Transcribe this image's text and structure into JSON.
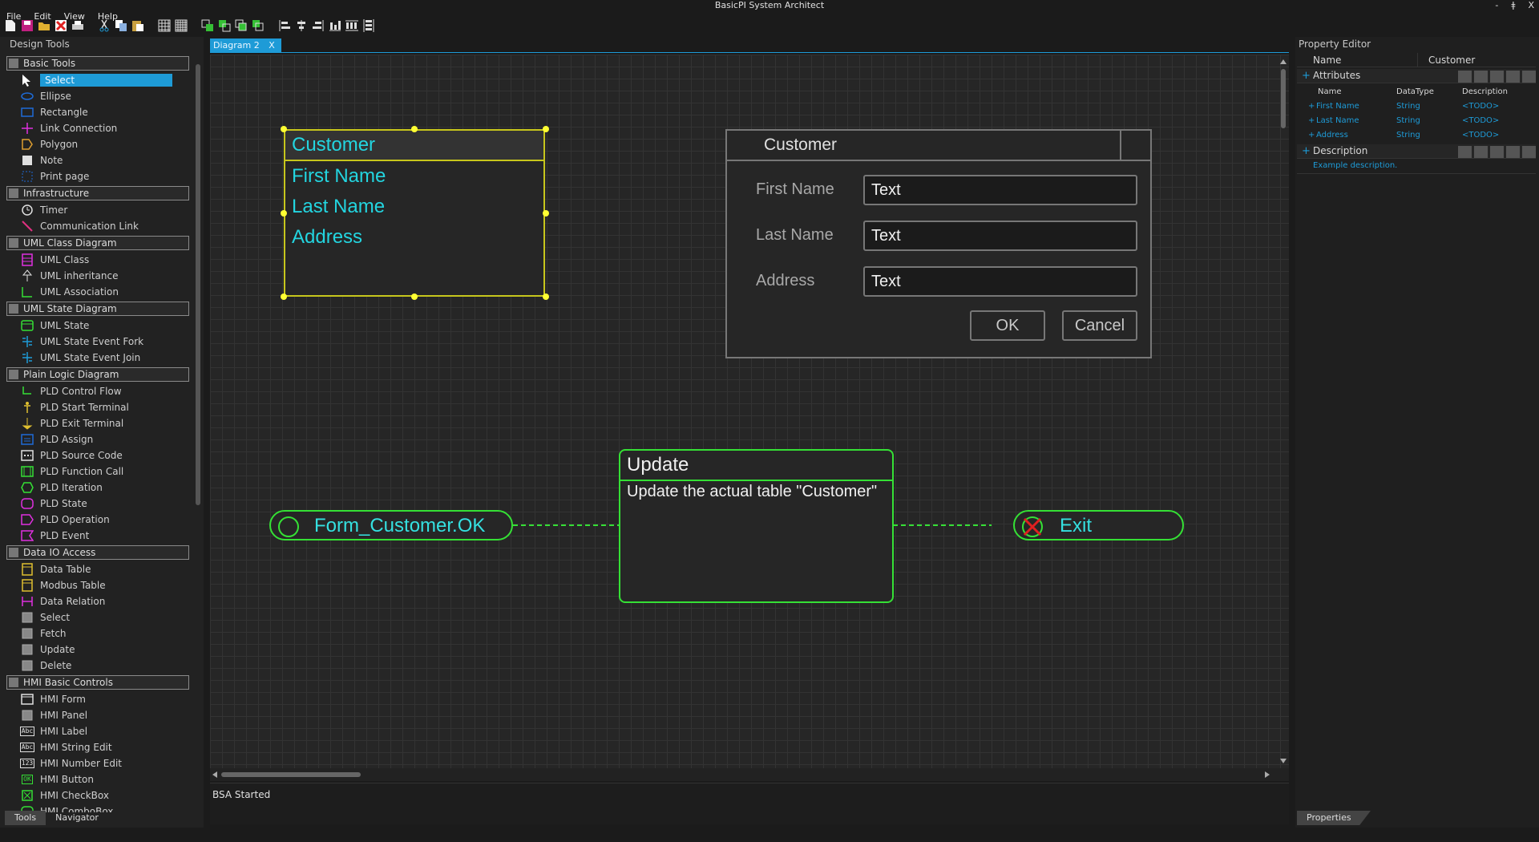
{
  "window": {
    "title": "BasicPI System Architect",
    "controls": [
      "-",
      "ǂ",
      "X"
    ]
  },
  "menu": [
    "File",
    "Edit",
    "View",
    "Help"
  ],
  "toolbar": {
    "icons": [
      "new-icon",
      "save-icon",
      "open-icon",
      "delete-icon",
      "print-icon",
      "cut-icon",
      "copy-icon",
      "paste-icon",
      "grid-icon",
      "grid-snap-icon",
      "bring-front-icon",
      "send-back-icon",
      "bring-forward-icon",
      "send-backward-icon",
      "align-left-icon",
      "align-center-icon",
      "align-right-icon",
      "align-bottom-icon",
      "distribute-h-icon",
      "distribute-v-icon"
    ]
  },
  "left_panel": {
    "title": "Design Tools",
    "groups": [
      {
        "name": "Basic Tools",
        "items": [
          {
            "label": "Select",
            "icon": "cursor-icon",
            "color": "#ffffff",
            "selected": true
          },
          {
            "label": "Ellipse",
            "icon": "ellipse-icon",
            "color": "#1e6bd7"
          },
          {
            "label": "Rectangle",
            "icon": "rectangle-icon",
            "color": "#1e6bd7"
          },
          {
            "label": "Link Connection",
            "icon": "link-icon",
            "color": "#e030e0"
          },
          {
            "label": "Polygon",
            "icon": "polygon-icon",
            "color": "#e0a030"
          },
          {
            "label": "Note",
            "icon": "note-icon",
            "color": "#e0e0e0"
          },
          {
            "label": "Print page",
            "icon": "print-page-icon",
            "color": "#1e6bd7"
          }
        ]
      },
      {
        "name": "Infrastructure",
        "items": [
          {
            "label": "Timer",
            "icon": "timer-icon",
            "color": "#e0e0e0"
          },
          {
            "label": "Communication Link",
            "icon": "comm-link-icon",
            "color": "#e03080"
          }
        ]
      },
      {
        "name": "UML Class Diagram",
        "items": [
          {
            "label": "UML Class",
            "icon": "uml-class-icon",
            "color": "#e030e0"
          },
          {
            "label": "UML inheritance",
            "icon": "uml-inheritance-icon",
            "color": "#e0e0e0"
          },
          {
            "label": "UML Association",
            "icon": "uml-association-icon",
            "color": "#35e035"
          }
        ]
      },
      {
        "name": "UML State Diagram",
        "items": [
          {
            "label": "UML State",
            "icon": "uml-state-icon",
            "color": "#35e035"
          },
          {
            "label": "UML State Event Fork",
            "icon": "fork-icon",
            "color": "#1e9bd7"
          },
          {
            "label": "UML State Event Join",
            "icon": "join-icon",
            "color": "#1e9bd7"
          }
        ]
      },
      {
        "name": "Plain Logic Diagram",
        "items": [
          {
            "label": "PLD Control Flow",
            "icon": "control-flow-icon",
            "color": "#35e035"
          },
          {
            "label": "PLD Start Terminal",
            "icon": "start-terminal-icon",
            "color": "#e0c030"
          },
          {
            "label": "PLD Exit Terminal",
            "icon": "exit-terminal-icon",
            "color": "#e0c030"
          },
          {
            "label": "PLD Assign",
            "icon": "assign-icon",
            "color": "#1e6bd7"
          },
          {
            "label": "PLD Source Code",
            "icon": "source-code-icon",
            "color": "#e0e0e0"
          },
          {
            "label": "PLD Function Call",
            "icon": "function-call-icon",
            "color": "#35e035"
          },
          {
            "label": "PLD Iteration",
            "icon": "iteration-icon",
            "color": "#35e035"
          },
          {
            "label": "PLD State",
            "icon": "pld-state-icon",
            "color": "#e030e0"
          },
          {
            "label": "PLD Operation",
            "icon": "operation-icon",
            "color": "#e030e0"
          },
          {
            "label": "PLD Event",
            "icon": "event-icon",
            "color": "#e030e0"
          }
        ]
      },
      {
        "name": "Data IO Access",
        "items": [
          {
            "label": "Data Table",
            "icon": "data-table-icon",
            "color": "#e0c030"
          },
          {
            "label": "Modbus Table",
            "icon": "modbus-table-icon",
            "color": "#e0c030"
          },
          {
            "label": "Data Relation",
            "icon": "data-relation-icon",
            "color": "#e030e0"
          },
          {
            "label": "Select",
            "icon": "select-query-icon",
            "color": "#888888"
          },
          {
            "label": "Fetch",
            "icon": "fetch-icon",
            "color": "#888888"
          },
          {
            "label": "Update",
            "icon": "update-icon",
            "color": "#888888"
          },
          {
            "label": "Delete",
            "icon": "delete-query-icon",
            "color": "#888888"
          }
        ]
      },
      {
        "name": "HMI Basic Controls",
        "items": [
          {
            "label": "HMI Form",
            "icon": "hmi-form-icon",
            "color": "#e0e0e0"
          },
          {
            "label": "HMI Panel",
            "icon": "hmi-panel-icon",
            "color": "#888888"
          },
          {
            "label": "HMI Label",
            "icon": "hmi-label-icon",
            "color": "#e0e0e0",
            "glyph": "Abc"
          },
          {
            "label": "HMI String Edit",
            "icon": "hmi-string-edit-icon",
            "color": "#e0e0e0",
            "glyph": "Abc"
          },
          {
            "label": "HMI Number Edit",
            "icon": "hmi-number-edit-icon",
            "color": "#e0e0e0",
            "glyph": "123"
          },
          {
            "label": "HMI Button",
            "icon": "hmi-button-icon",
            "color": "#35e035",
            "glyph": "OK"
          },
          {
            "label": "HMI CheckBox",
            "icon": "hmi-checkbox-icon",
            "color": "#35e035"
          },
          {
            "label": "HMI ComboBox",
            "icon": "hmi-combobox-icon",
            "color": "#35e035"
          }
        ]
      }
    ],
    "tabs": [
      "Tools",
      "Navigator"
    ]
  },
  "document": {
    "tab": {
      "label": "Diagram 2",
      "close": "X"
    },
    "uml_class": {
      "name": "Customer",
      "attributes": [
        "First Name",
        "Last Name",
        "Address"
      ]
    },
    "hmi_form": {
      "title": "Customer",
      "fields": [
        {
          "label": "First Name",
          "value": "Text"
        },
        {
          "label": "Last Name",
          "value": "Text"
        },
        {
          "label": "Address",
          "value": "Text"
        }
      ],
      "ok_label": "OK",
      "cancel_label": "Cancel"
    },
    "start_terminal": {
      "label": "Form_Customer.OK"
    },
    "operation": {
      "title": "Update",
      "body": "Update the actual table \"Customer\""
    },
    "exit_terminal": {
      "label": "Exit"
    },
    "status": "BSA Started"
  },
  "colors": {
    "accent": "#1e9bd7",
    "uml": "#c7c61c",
    "pld": "#35e035",
    "text_cyan": "#23d5e0",
    "exit_x": "#e02020"
  },
  "property_editor": {
    "title": "Property Editor",
    "name_label": "Name",
    "name_value": "Customer",
    "attributes_label": "Attributes",
    "columns": [
      "Name",
      "DataType",
      "Description"
    ],
    "rows": [
      {
        "name": "First Name",
        "type": "String",
        "desc": "<TODO>"
      },
      {
        "name": "Last Name",
        "type": "String",
        "desc": "<TODO>"
      },
      {
        "name": "Address",
        "type": "String",
        "desc": "<TODO>"
      }
    ],
    "description_label": "Description",
    "description_value": "Example description.",
    "tab": "Properties"
  }
}
